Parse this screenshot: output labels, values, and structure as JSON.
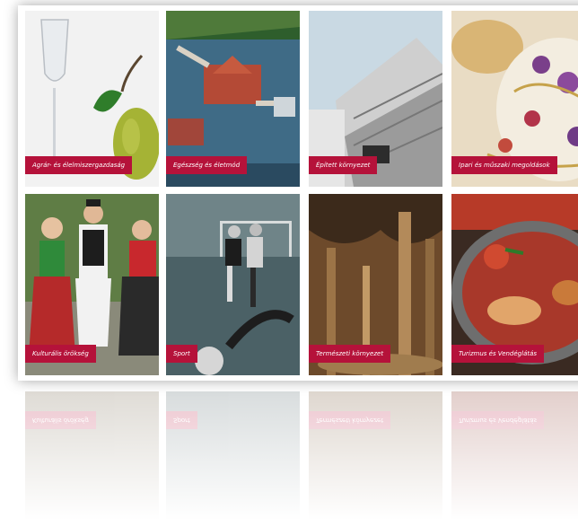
{
  "tiles": [
    {
      "label": "Agrár- és élelmiszergazdaság",
      "icon": "glass-and-pear-image"
    },
    {
      "label": "Egészség és életmód",
      "icon": "lake-bath-image"
    },
    {
      "label": "Épített környezet",
      "icon": "building-facade-image"
    },
    {
      "label": "Ipari és műszaki megoldások",
      "icon": "porcelain-image"
    },
    {
      "label": "Kulturális örökség",
      "icon": "folk-costume-image"
    },
    {
      "label": "Sport",
      "icon": "football-match-image"
    },
    {
      "label": "Természeti környezet",
      "icon": "cave-image"
    },
    {
      "label": "Turizmus és Vendéglátás",
      "icon": "goulash-image"
    }
  ],
  "colors": {
    "label_bg": "#b5123a",
    "label_text": "#ffffff"
  }
}
